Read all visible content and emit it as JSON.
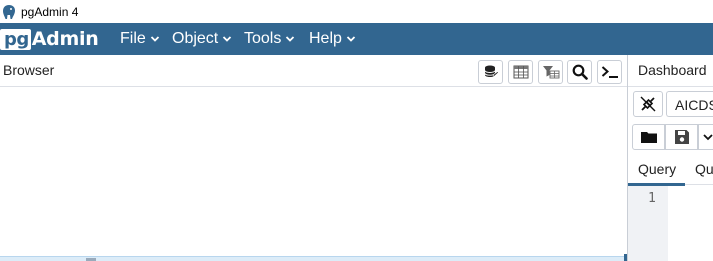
{
  "window": {
    "title": "pgAdmin 4"
  },
  "logo": {
    "pg": "pg",
    "admin": "Admin"
  },
  "menu": {
    "items": [
      {
        "label": "File"
      },
      {
        "label": "Object"
      },
      {
        "label": "Tools"
      },
      {
        "label": "Help"
      }
    ]
  },
  "browser": {
    "title": "Browser",
    "toolbar": [
      "query-tool-icon",
      "view-data-icon",
      "filtered-rows-icon",
      "search-objects-icon",
      "psql-tool-icon"
    ]
  },
  "right_panel": {
    "tab_dashboard": "Dashboard",
    "connection_value": "AICDS",
    "query_tabs": {
      "query": "Query",
      "query_history": "Qu"
    },
    "editor": {
      "line_numbers": [
        "1"
      ]
    }
  },
  "colors": {
    "brand": "#326690",
    "menu_text": "#ffffff"
  }
}
